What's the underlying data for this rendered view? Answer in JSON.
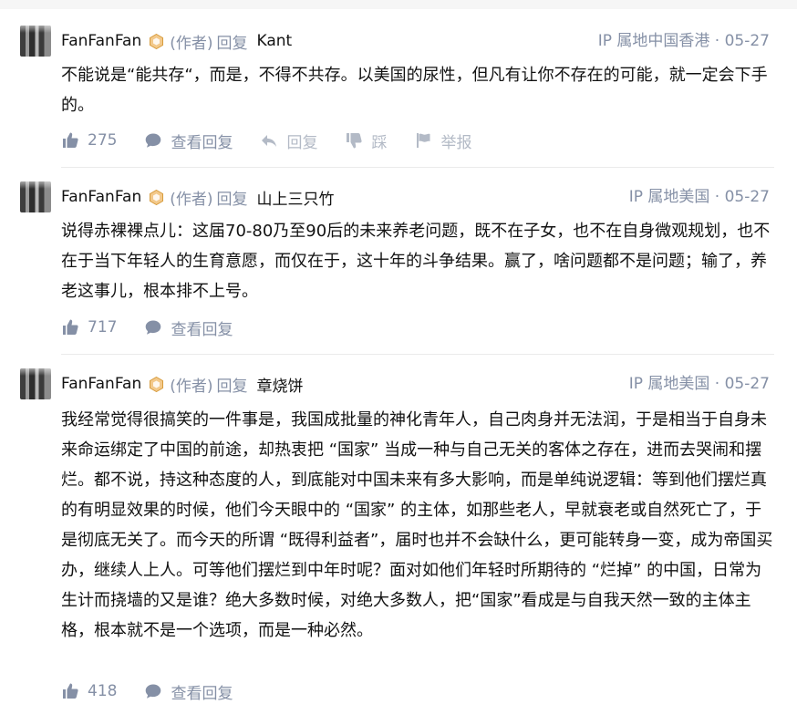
{
  "comments": [
    {
      "author": "FanFanFan",
      "role": "(作者)",
      "reply_word": "回复",
      "reply_to": "Kant",
      "meta": "IP 属地中国香港 · 05-27",
      "text": "不能说是“能共存“，而是，不得不共存。以美国的尿性，但凡有让你不存在的可能，就一定会下手的。",
      "likes": "275",
      "view_replies": "查看回复",
      "reply": "回复",
      "dislike": "踩",
      "report": "举报"
    },
    {
      "author": "FanFanFan",
      "role": "(作者)",
      "reply_word": "回复",
      "reply_to": "山上三只竹",
      "meta": "IP 属地美国 · 05-27",
      "text": "说得赤裸裸点儿：这届70-80乃至90后的未来养老问题，既不在子女，也不在自身微观规划，也不在于当下年轻人的生育意愿，而仅在于，这十年的斗争结果。赢了，啥问题都不是问题；输了，养老这事儿，根本排不上号。",
      "likes": "717",
      "view_replies": "查看回复"
    },
    {
      "author": "FanFanFan",
      "role": "(作者)",
      "reply_word": "回复",
      "reply_to": "章烧饼",
      "meta": "IP 属地美国 · 05-27",
      "text": "我经常觉得很搞笑的一件事是，我国成批量的神化青年人，自己肉身并无法润，于是相当于自身未来命运绑定了中国的前途，却热衷把 “国家” 当成一种与自己无关的客体之存在，进而去哭闹和摆烂。都不说，持这种态度的人，到底能对中国未来有多大影响，而是单纯说逻辑：等到他们摆烂真的有明显效果的时候，他们今天眼中的 “国家” 的主体，如那些老人，早就衰老或自然死亡了，于是彻底无关了。而今天的所谓 “既得利益者”，届时也并不会缺什么，更可能转身一变，成为帝国买办，继续人上人。可等他们摆烂到中年时呢？面对如他们年轻时所期待的 “烂掉” 的中国，日常为生计而挠墙的又是谁？绝大多数时候，对绝大多数人，把“国家”看成是与自我天然一致的主体主格，根本就不是一个选项，而是一种必然。",
      "likes": "418",
      "view_replies": "查看回复"
    }
  ]
}
